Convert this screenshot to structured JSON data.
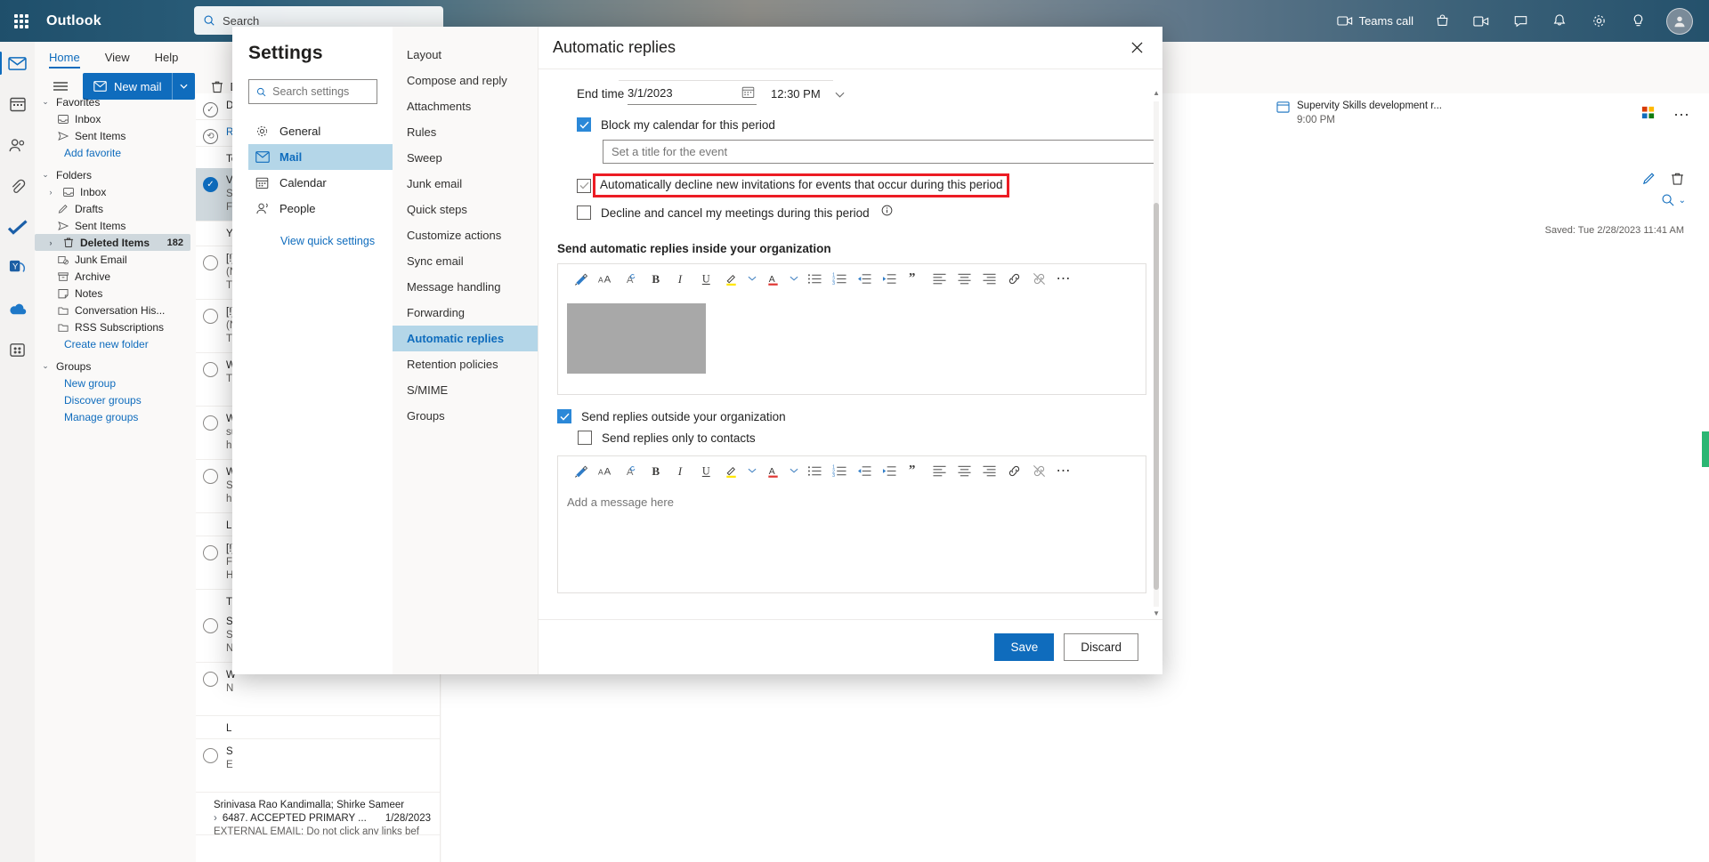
{
  "topbar": {
    "brand": "Outlook",
    "search_placeholder": "Search",
    "teams_call": "Teams call",
    "icons": [
      "waffle-icon",
      "video-call-icon",
      "shop-icon",
      "meet-now-icon",
      "feedback-icon",
      "notifications-bell-icon",
      "settings-gear-icon",
      "lightbulb-icon",
      "account-avatar"
    ]
  },
  "ribbon": {
    "tabs": [
      "Home",
      "View",
      "Help"
    ],
    "selected_tab": "Home",
    "new_mail": "New mail",
    "delete": "Del"
  },
  "folders": {
    "favorites_label": "Favorites",
    "favorites": [
      "Inbox",
      "Sent Items"
    ],
    "add_favorite": "Add favorite",
    "folders_label": "Folders",
    "items": [
      {
        "label": "Inbox",
        "count": ""
      },
      {
        "label": "Drafts",
        "count": ""
      },
      {
        "label": "Sent Items",
        "count": ""
      },
      {
        "label": "Deleted Items",
        "count": "182"
      },
      {
        "label": "Junk Email",
        "count": ""
      },
      {
        "label": "Archive",
        "count": ""
      },
      {
        "label": "Notes",
        "count": ""
      },
      {
        "label": "Conversation His...",
        "count": ""
      },
      {
        "label": "RSS Subscriptions",
        "count": ""
      }
    ],
    "create_new_folder": "Create new folder",
    "groups_label": "Groups",
    "group_links": [
      "New group",
      "Discover groups",
      "Manage groups"
    ]
  },
  "maillist": {
    "rows": [
      {
        "l1": "D",
        "l2": "",
        "l3": ""
      },
      {
        "l1": "Re",
        "l2": "",
        "l3": ""
      },
      {
        "l1": "Te",
        "l2": "",
        "l3": ""
      },
      {
        "l1": "Va",
        "l2": "Su",
        "l3": "FY"
      },
      {
        "l1": "Yo",
        "l2": "",
        "l3": ""
      },
      {
        "l1": "[!]",
        "l2": "(N",
        "l3": "Th"
      },
      {
        "l1": "[!]",
        "l2": "(N",
        "l3": "Th"
      },
      {
        "l1": "W",
        "l2": "Th",
        "l3": ""
      },
      {
        "l1": "W",
        "l2": "su",
        "l3": "h"
      },
      {
        "l1": "W",
        "l2": "Se",
        "l3": "h"
      },
      {
        "l1": "L",
        "l2": "",
        "l3": ""
      },
      {
        "l1": "[!]",
        "l2": "Fr",
        "l3": "H"
      },
      {
        "l1": "Th",
        "l2": "",
        "l3": ""
      },
      {
        "l1": "S",
        "l2": "Se",
        "l3": "N"
      },
      {
        "l1": "W",
        "l2": "",
        "l3": "N"
      },
      {
        "l1": "L",
        "l2": "",
        "l3": ""
      },
      {
        "l1": "S",
        "l2": "E",
        "l3": ""
      }
    ],
    "last": {
      "sender": "Srinivasa Rao Kandimalla; Shirke Sameer",
      "subject": "6487. ACCEPTED PRIMARY ...",
      "date": "1/28/2023",
      "preview": "EXTERNAL EMAIL: Do not click any links bef"
    }
  },
  "readpane": {
    "event_title": "Supervity Skills development r...",
    "event_time": "9:00 PM",
    "saved": "Saved: Tue 2/28/2023 11:41 AM"
  },
  "settings": {
    "title": "Settings",
    "search_placeholder": "Search settings",
    "nav": [
      {
        "label": "General",
        "icon": "gear-icon"
      },
      {
        "label": "Mail",
        "icon": "mail-icon"
      },
      {
        "label": "Calendar",
        "icon": "calendar-icon"
      },
      {
        "label": "People",
        "icon": "people-icon"
      }
    ],
    "nav_selected": "Mail",
    "quick_settings_link": "View quick settings",
    "sub_nav": [
      "Layout",
      "Compose and reply",
      "Attachments",
      "Rules",
      "Sweep",
      "Junk email",
      "Quick steps",
      "Customize actions",
      "Sync email",
      "Message handling",
      "Forwarding",
      "Automatic replies",
      "Retention policies",
      "S/MIME",
      "Groups"
    ],
    "sub_nav_selected": "Automatic replies",
    "panel": {
      "heading": "Automatic replies",
      "end_time_label": "End time",
      "end_date_value": "3/1/2023",
      "end_time_value": "12:30 PM",
      "block_calendar_label": "Block my calendar for this period",
      "block_calendar_checked": true,
      "event_title_placeholder": "Set a title for the event",
      "auto_decline_label": "Automatically decline new invitations for events that occur during this period",
      "auto_decline_checked": false,
      "decline_cancel_label": "Decline and cancel my meetings during this period",
      "decline_cancel_checked": false,
      "inside_org_heading": "Send automatic replies inside your organization",
      "outside_org_label": "Send replies outside your organization",
      "outside_org_checked": true,
      "only_contacts_label": "Send replies only to contacts",
      "only_contacts_checked": false,
      "outside_editor_placeholder": "Add a message here",
      "save_label": "Save",
      "discard_label": "Discard",
      "close_icon": "close-icon",
      "highlight_color": "#ec1c24"
    },
    "toolbar_icons": [
      "format-painter-icon",
      "font-size-icon",
      "clear-formatting-icon",
      "bold-icon",
      "italic-icon",
      "underline-icon",
      "highlight-color-icon",
      "highlight-chevron-icon",
      "font-color-icon",
      "font-color-chevron-icon",
      "bulleted-list-icon",
      "numbered-list-icon",
      "decrease-indent-icon",
      "increase-indent-icon",
      "quote-icon",
      "align-left-icon",
      "align-center-icon",
      "align-right-icon",
      "insert-link-icon",
      "remove-link-icon",
      "more-options-icon"
    ]
  },
  "colors": {
    "accent": "#0f6cbd",
    "nav_selected_bg": "#b4d6e8",
    "checkbox_on": "#2b88d8",
    "highlight_red": "#ec1c24"
  }
}
